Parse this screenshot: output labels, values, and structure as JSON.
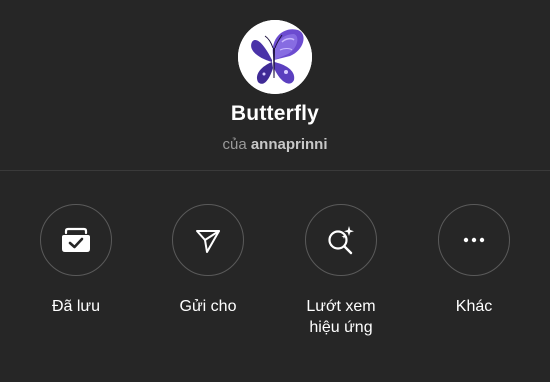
{
  "effect": {
    "name": "Butterfly",
    "by_prefix": "của",
    "creator": "annaprinni",
    "avatar_icon": "butterfly-thumbnail"
  },
  "actions": [
    {
      "id": "saved",
      "label": "Đã lưu",
      "icon": "saved-check-icon"
    },
    {
      "id": "send",
      "label": "Gửi cho",
      "icon": "send-paper-plane-icon"
    },
    {
      "id": "browse",
      "label": "Lướt xem\nhiệu ứng",
      "icon": "search-sparkle-icon"
    },
    {
      "id": "more",
      "label": "Khác",
      "icon": "more-dots-icon"
    }
  ],
  "colors": {
    "background": "#262626",
    "circle_border": "#5a5a5a",
    "muted_text": "#9a9a9a",
    "butterfly_purple": "#5a3fb8"
  }
}
